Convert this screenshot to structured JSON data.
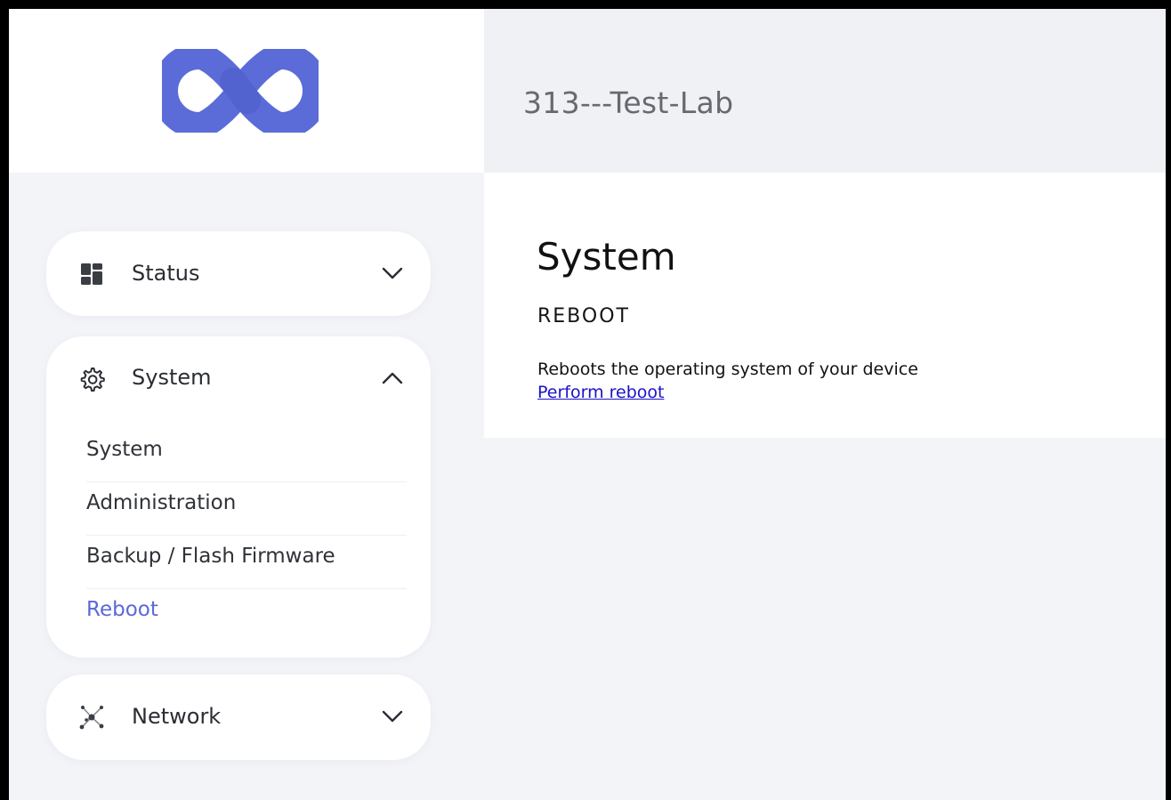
{
  "header": {
    "hostname": "313---Test-Lab",
    "logo_icon": "infinity-logo-icon",
    "logo_color": "#5b6cd8"
  },
  "sidebar": {
    "sections": [
      {
        "label": "Status",
        "icon": "dashboard-grid-icon",
        "expanded": false
      },
      {
        "label": "System",
        "icon": "gear-icon",
        "expanded": true,
        "items": [
          {
            "label": "System",
            "active": false
          },
          {
            "label": "Administration",
            "active": false
          },
          {
            "label": "Backup / Flash Firmware",
            "active": false
          },
          {
            "label": "Reboot",
            "active": true
          }
        ]
      },
      {
        "label": "Network",
        "icon": "network-nodes-icon",
        "expanded": false
      }
    ],
    "active_color": "#5a69d8"
  },
  "main": {
    "title": "System",
    "subtitle": "REBOOT",
    "description": "Reboots the operating system of your device",
    "action_label": "Perform reboot",
    "link_color": "#1a12c9"
  }
}
